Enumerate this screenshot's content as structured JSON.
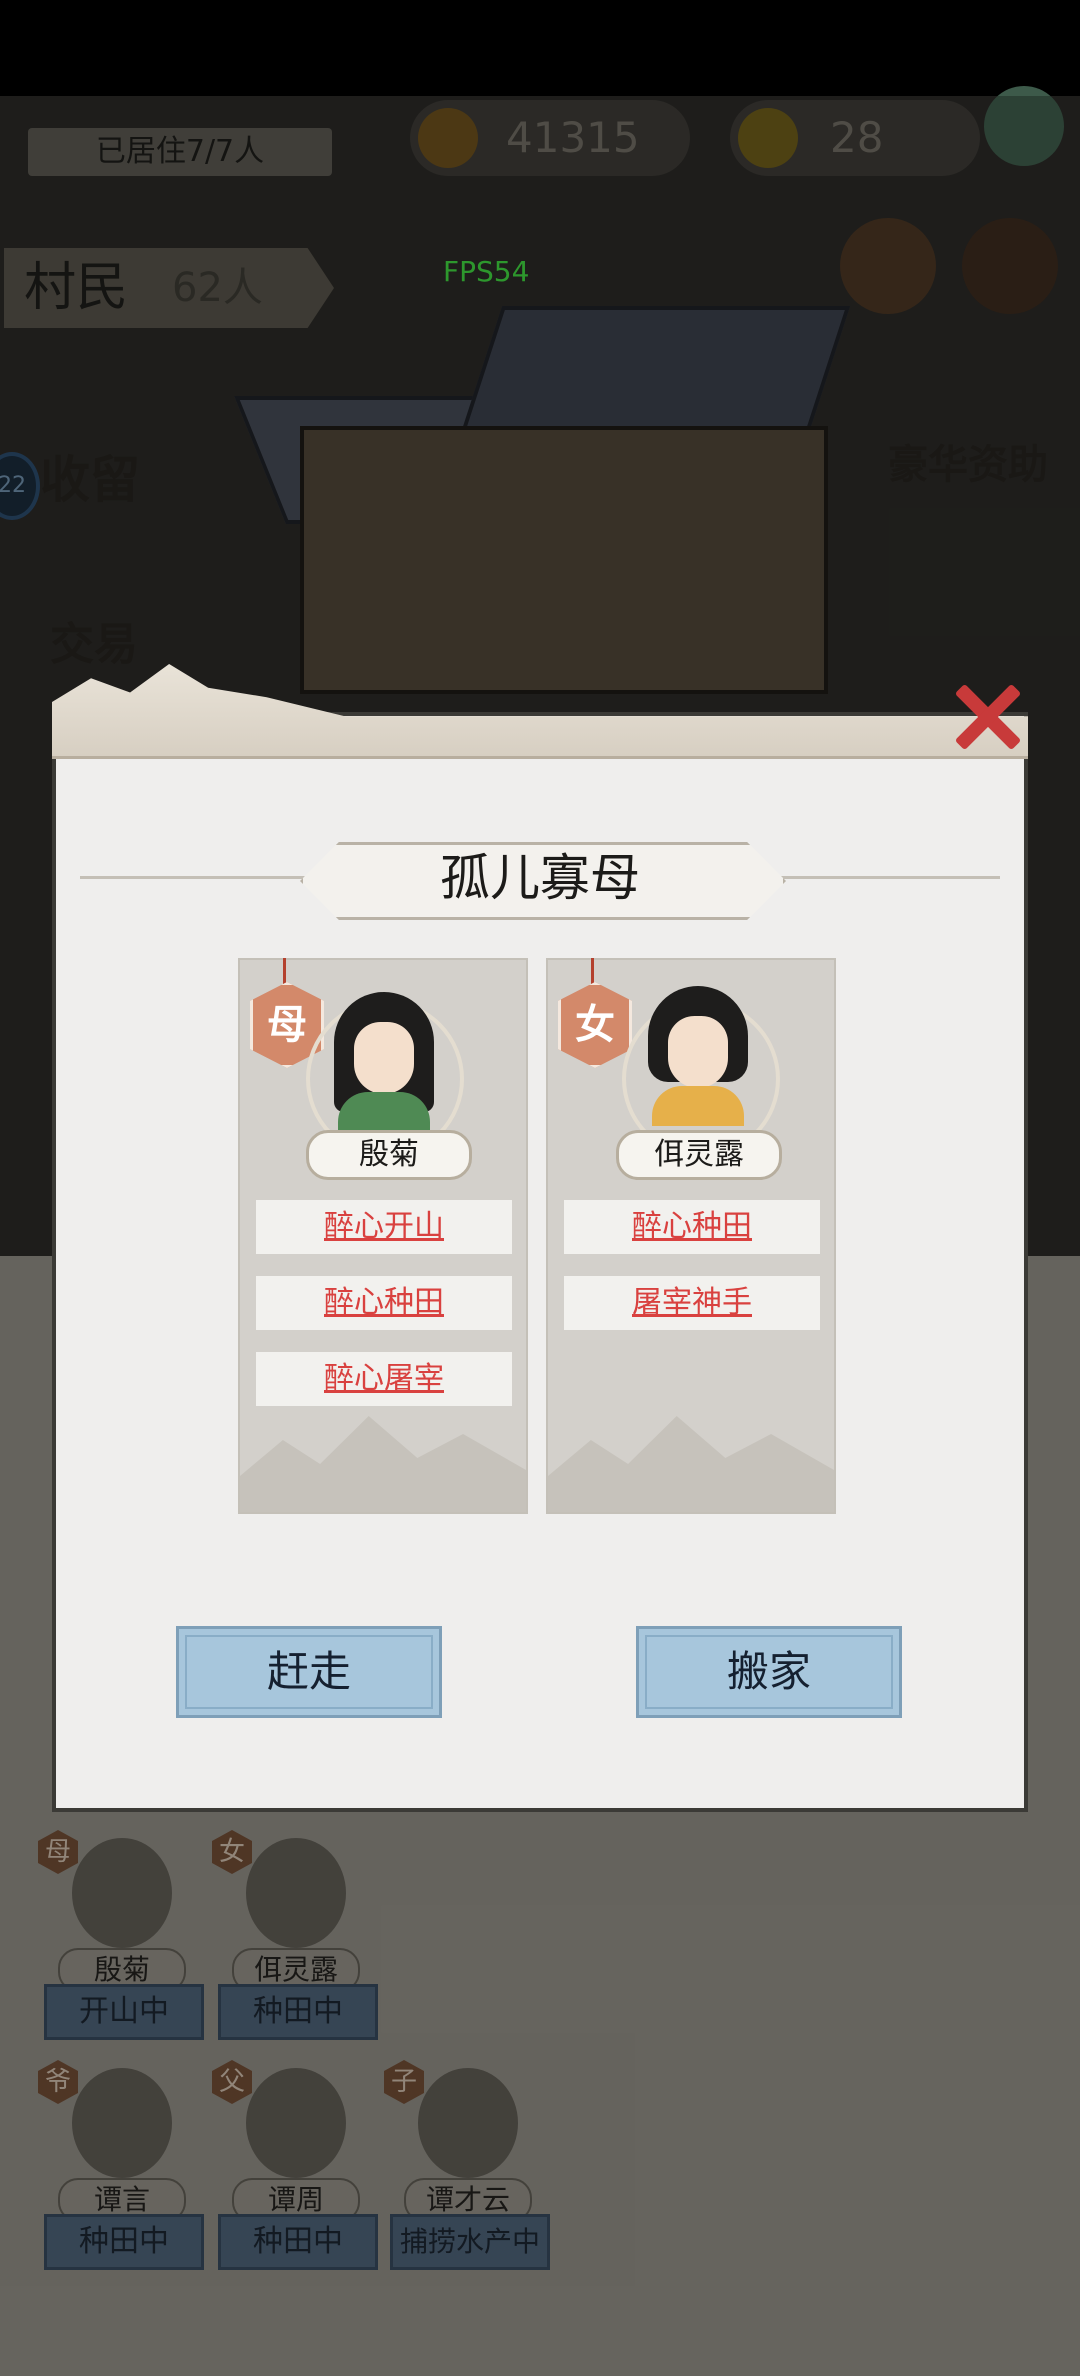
{
  "status_bar": {},
  "background": {
    "occupancy": "已居住7/7人",
    "coins": "41315",
    "gold": "28",
    "villagers_label": "村民",
    "villagers_count": "62人",
    "fps": "FPS54",
    "shelter_label": "收留",
    "trade_label": "交易",
    "sponsor_label": "豪华资助",
    "badge_number": "22",
    "residents_row1": [
      {
        "role": "母",
        "name": "殷菊",
        "job": "开山中"
      },
      {
        "role": "女",
        "name": "佴灵露",
        "job": "种田中"
      }
    ],
    "residents_row2": [
      {
        "role": "爷",
        "name": "谭言",
        "job": "种田中"
      },
      {
        "role": "父",
        "name": "谭周",
        "job": "种田中"
      },
      {
        "role": "子",
        "name": "谭才云",
        "job": "捕捞水产中"
      }
    ]
  },
  "dialog": {
    "title": "孤儿寡母",
    "members": [
      {
        "role": "母",
        "name": "殷菊",
        "skills": [
          "醉心开山",
          "醉心种田",
          "醉心屠宰"
        ]
      },
      {
        "role": "女",
        "name": "佴灵露",
        "skills": [
          "醉心种田",
          "屠宰神手"
        ]
      }
    ],
    "evict_label": "赶走",
    "move_label": "搬家"
  },
  "colors": {
    "skill_text": "#d9413f",
    "button_bg": "#a7c6dc",
    "role_tag": "#d3896a",
    "close_x": "#c83a3a"
  }
}
